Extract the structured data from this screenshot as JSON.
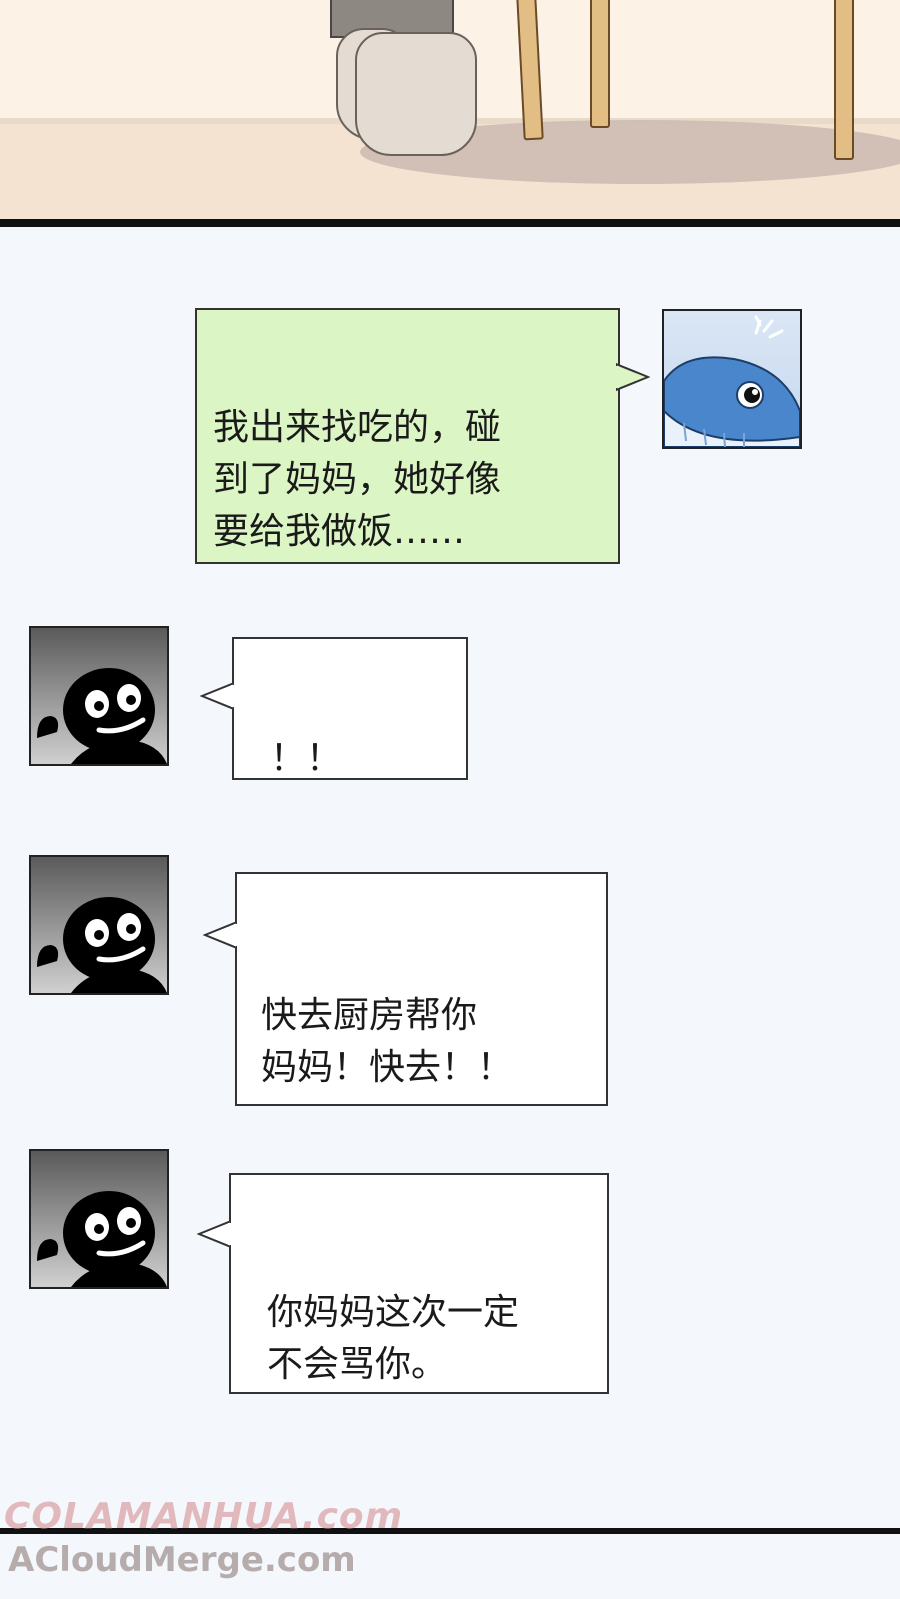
{
  "messages": [
    {
      "sender": "whale",
      "side": "right",
      "text": "我出来找吃的，碰\n到了妈妈，她好像\n要给我做饭……"
    },
    {
      "sender": "stick",
      "side": "left",
      "text": "！！"
    },
    {
      "sender": "stick",
      "side": "left",
      "text": "快去厨房帮你\n妈妈！快去！！"
    },
    {
      "sender": "stick",
      "side": "left",
      "text": "你妈妈这次一定\n不会骂你。"
    }
  ],
  "watermark": {
    "line1": "COLAMANHUA.com",
    "line2": "ACloudMerge.com"
  },
  "colors": {
    "green_bubble": "#dcf5c4",
    "white_bubble": "#ffffff",
    "background": "#f4f8fc"
  }
}
